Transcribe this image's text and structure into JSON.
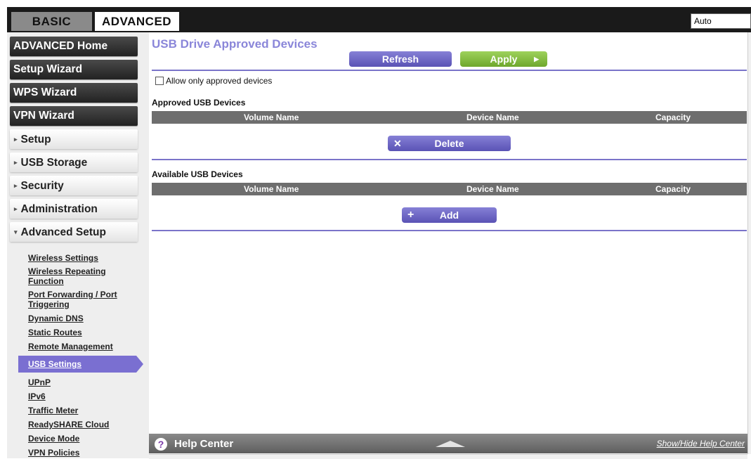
{
  "tabs": {
    "basic": "BASIC",
    "advanced": "ADVANCED"
  },
  "language": {
    "selected": "Auto"
  },
  "sidebar": {
    "main_buttons": [
      {
        "label": "ADVANCED Home"
      },
      {
        "label": "Setup Wizard"
      },
      {
        "label": "WPS Wizard"
      },
      {
        "label": "VPN Wizard"
      }
    ],
    "sections": [
      {
        "label": "Setup",
        "arrow": "▸"
      },
      {
        "label": "USB Storage",
        "arrow": "▸"
      },
      {
        "label": "Security",
        "arrow": "▸"
      },
      {
        "label": "Administration",
        "arrow": "▸"
      },
      {
        "label": "Advanced Setup",
        "arrow": "▾"
      }
    ],
    "sublinks": [
      {
        "label": "Wireless Settings"
      },
      {
        "label": "Wireless Repeating Function"
      },
      {
        "label": "Port Forwarding / Port Triggering"
      },
      {
        "label": "Dynamic DNS"
      },
      {
        "label": "Static Routes"
      },
      {
        "label": "Remote Management"
      },
      {
        "label": "USB Settings"
      },
      {
        "label": "UPnP"
      },
      {
        "label": "IPv6"
      },
      {
        "label": "Traffic Meter"
      },
      {
        "label": "ReadySHARE Cloud"
      },
      {
        "label": "Device Mode"
      },
      {
        "label": "VPN Policies"
      }
    ]
  },
  "main": {
    "title": "USB Drive Approved Devices",
    "refresh_label": "Refresh",
    "apply_label": "Apply",
    "allow_only_label": "Allow only approved devices",
    "approved_section": "Approved USB Devices",
    "available_section": "Available USB Devices",
    "columns": [
      "Volume Name",
      "Device Name",
      "Capacity"
    ],
    "delete_label": "Delete",
    "add_label": "Add"
  },
  "help": {
    "title": "Help Center",
    "toggle_link": "Show/Hide Help Center"
  },
  "colors": {
    "accent": "#7a74c9",
    "green": "#7ab83a",
    "dark": "#1a1a1a"
  }
}
